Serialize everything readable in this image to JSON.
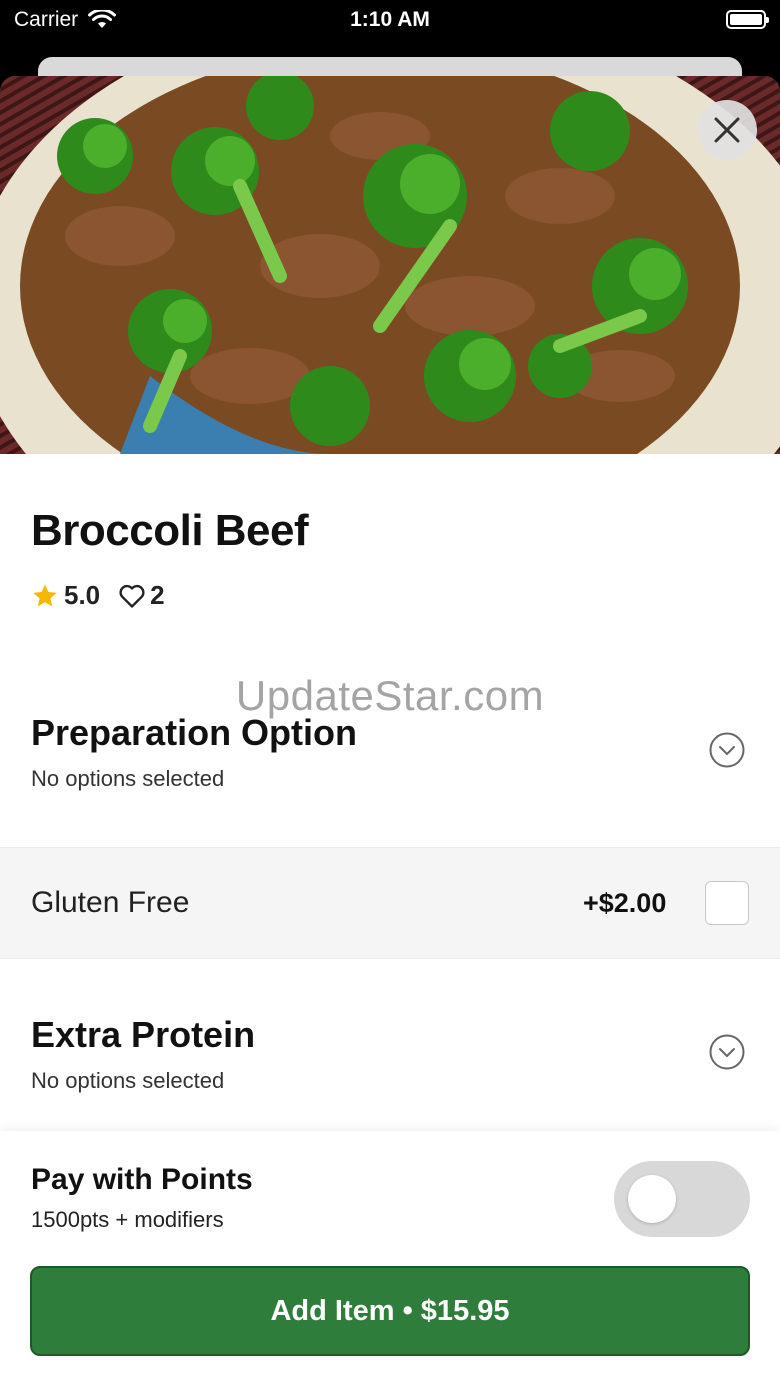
{
  "status_bar": {
    "carrier": "Carrier",
    "time": "1:10 AM"
  },
  "item": {
    "name": "Broccoli Beef",
    "rating": "5.0",
    "likes": "2"
  },
  "watermark": "UpdateStar.com",
  "sections": [
    {
      "title": "Preparation Option",
      "subtitle": "No options selected"
    },
    {
      "title": "Extra Protein",
      "subtitle": "No options selected"
    }
  ],
  "options": [
    {
      "label": "Gluten Free",
      "price": "+$2.00"
    }
  ],
  "pay_with_points": {
    "title": "Pay with Points",
    "subtitle": "1500pts + modifiers"
  },
  "add_button": {
    "label": "Add Item • $15.95"
  },
  "colors": {
    "accent": "#2e7d3a",
    "star": "#f5b800"
  },
  "icons": [
    "wifi-icon",
    "battery-icon",
    "close-icon",
    "star-icon",
    "heart-icon",
    "chevron-down-icon"
  ]
}
